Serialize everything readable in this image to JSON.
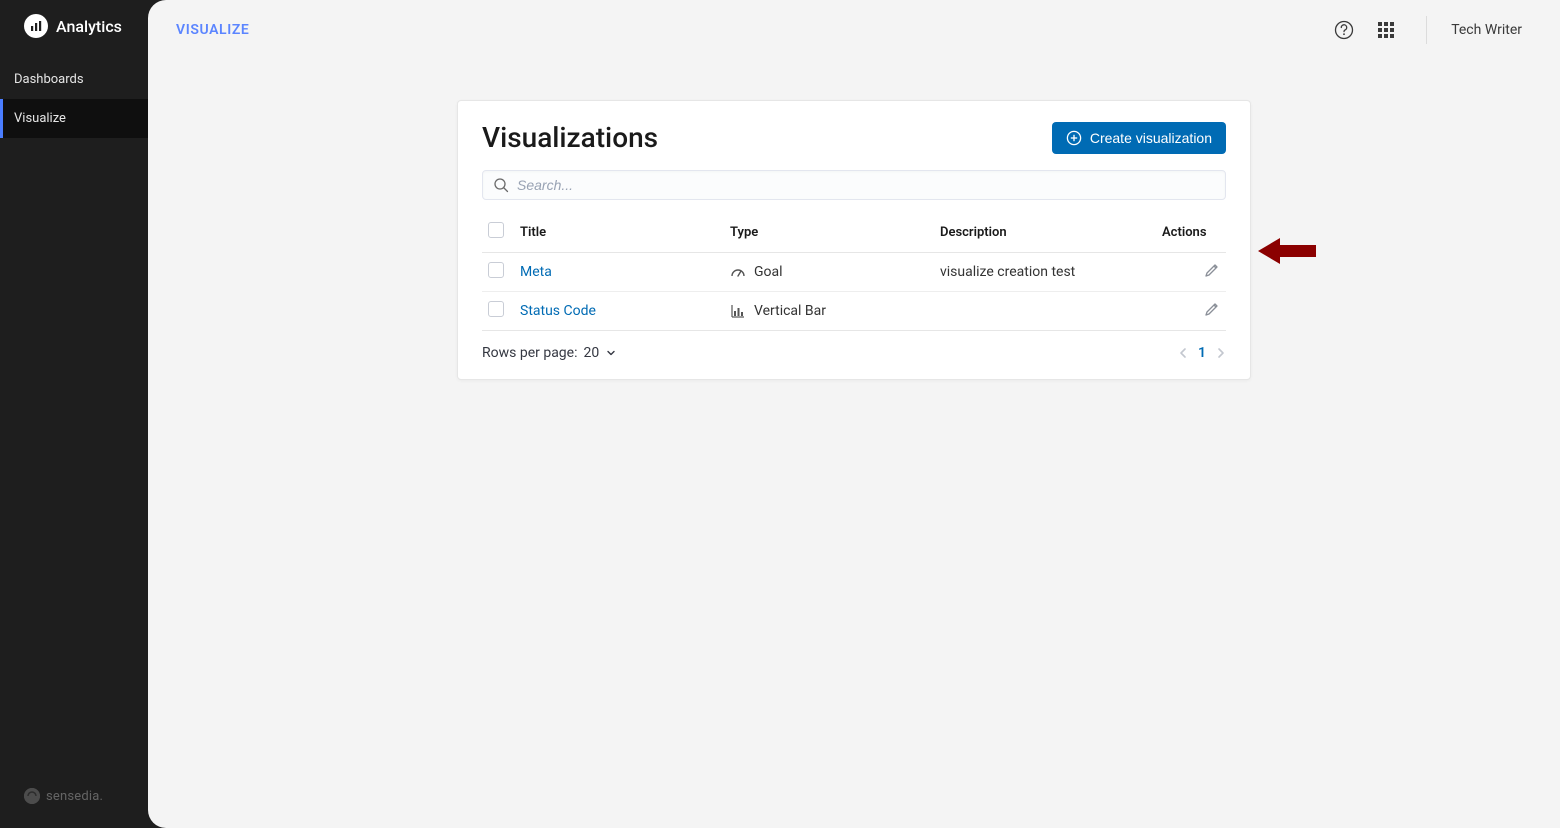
{
  "brand": {
    "name": "Analytics",
    "footer": "sensedia."
  },
  "sidebar": {
    "items": [
      {
        "label": "Dashboards"
      },
      {
        "label": "Visualize"
      }
    ],
    "activeIndex": 1
  },
  "topbar": {
    "title": "VISUALIZE",
    "user": "Tech Writer"
  },
  "card": {
    "heading": "Visualizations",
    "createLabel": "Create visualization",
    "searchPlaceholder": "Search...",
    "columns": {
      "title": "Title",
      "type": "Type",
      "description": "Description",
      "actions": "Actions"
    },
    "rows": [
      {
        "title": "Meta",
        "typeIcon": "goal",
        "typeLabel": "Goal",
        "description": "visualize creation test"
      },
      {
        "title": "Status Code",
        "typeIcon": "vbar",
        "typeLabel": "Vertical Bar",
        "description": ""
      }
    ],
    "rowsPerPageLabel": "Rows per page:",
    "rowsPerPageValue": "20",
    "currentPage": "1"
  }
}
